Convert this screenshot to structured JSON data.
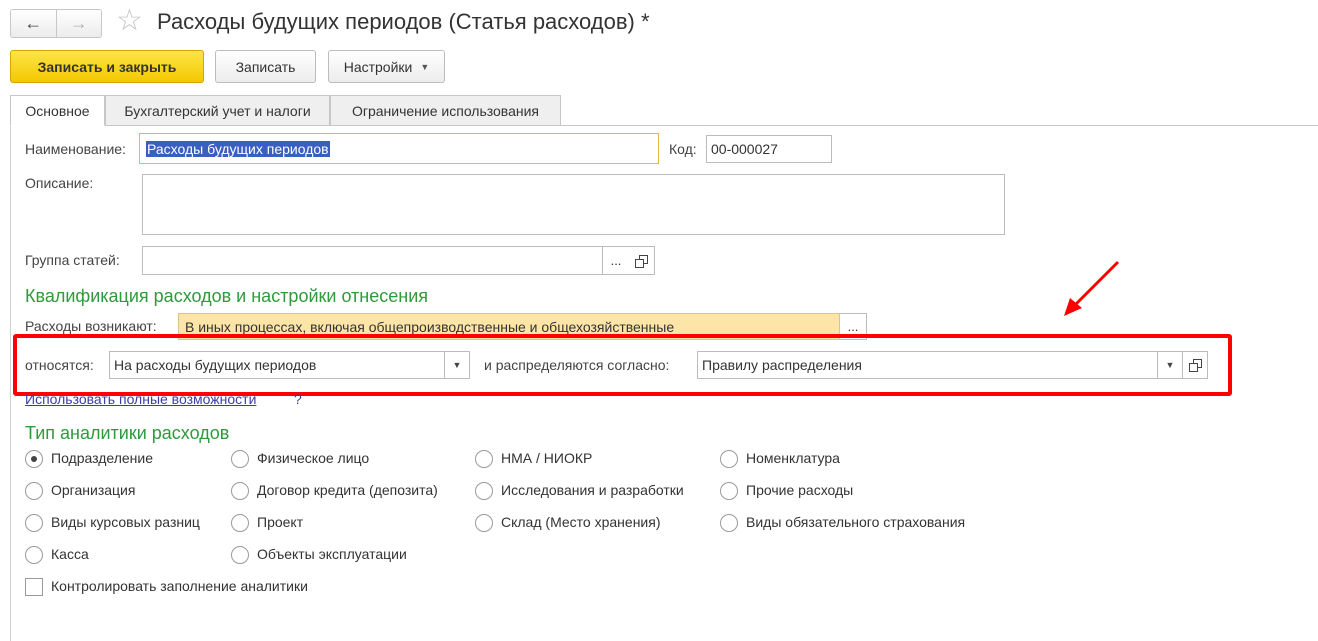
{
  "window": {
    "title": "Расходы будущих периодов (Статья расходов) *",
    "back_icon": "←",
    "forward_icon": "→",
    "star_icon": "☆"
  },
  "toolbar": {
    "save_close_label": "Записать и закрыть",
    "save_label": "Записать",
    "settings_label": "Настройки"
  },
  "tabs": [
    {
      "label": "Основное",
      "active": true
    },
    {
      "label": "Бухгалтерский учет и налоги",
      "active": false
    },
    {
      "label": "Ограничение использования",
      "active": false
    }
  ],
  "form": {
    "name_label": "Наименование:",
    "name_value": "Расходы будущих периодов",
    "code_label": "Код:",
    "code_value": "00-000027",
    "description_label": "Описание:",
    "description_value": "",
    "group_label": "Группа статей:",
    "group_value": "",
    "more_button": "...",
    "qualification_title": "Квалификация расходов и настройки отнесения",
    "arise_label": "Расходы возникают:",
    "arise_value": "В иных процессах, включая общепроизводственные и общехозяйственные",
    "relate_label": "относятся:",
    "relate_value": "На расходы будущих периодов",
    "distribute_label": "и распределяются согласно:",
    "distribute_value": "Правилу распределения",
    "full_features_link": "Использовать полные возможности",
    "help_mark": "?",
    "analytics_title": "Тип аналитики расходов",
    "control_checkbox_label": "Контролировать заполнение аналитики",
    "control_checked": false
  },
  "analytics_options": {
    "col1": [
      "Подразделение",
      "Организация",
      "Виды курсовых разниц",
      "Касса"
    ],
    "col2": [
      "Физическое лицо",
      "Договор кредита (депозита)",
      "Проект",
      "Объекты эксплуатации"
    ],
    "col3": [
      "НМА / НИОКР",
      "Исследования и разработки",
      "Склад (Место хранения)"
    ],
    "col4": [
      "Номенклатура",
      "Прочие расходы",
      "Виды обязательного страхования"
    ],
    "selected": "Подразделение"
  },
  "colors": {
    "accent_yellow": "#f4c800",
    "section_green": "#2e9a3c",
    "highlight_red": "#ff0000",
    "link_blue": "#3a3fa0"
  }
}
